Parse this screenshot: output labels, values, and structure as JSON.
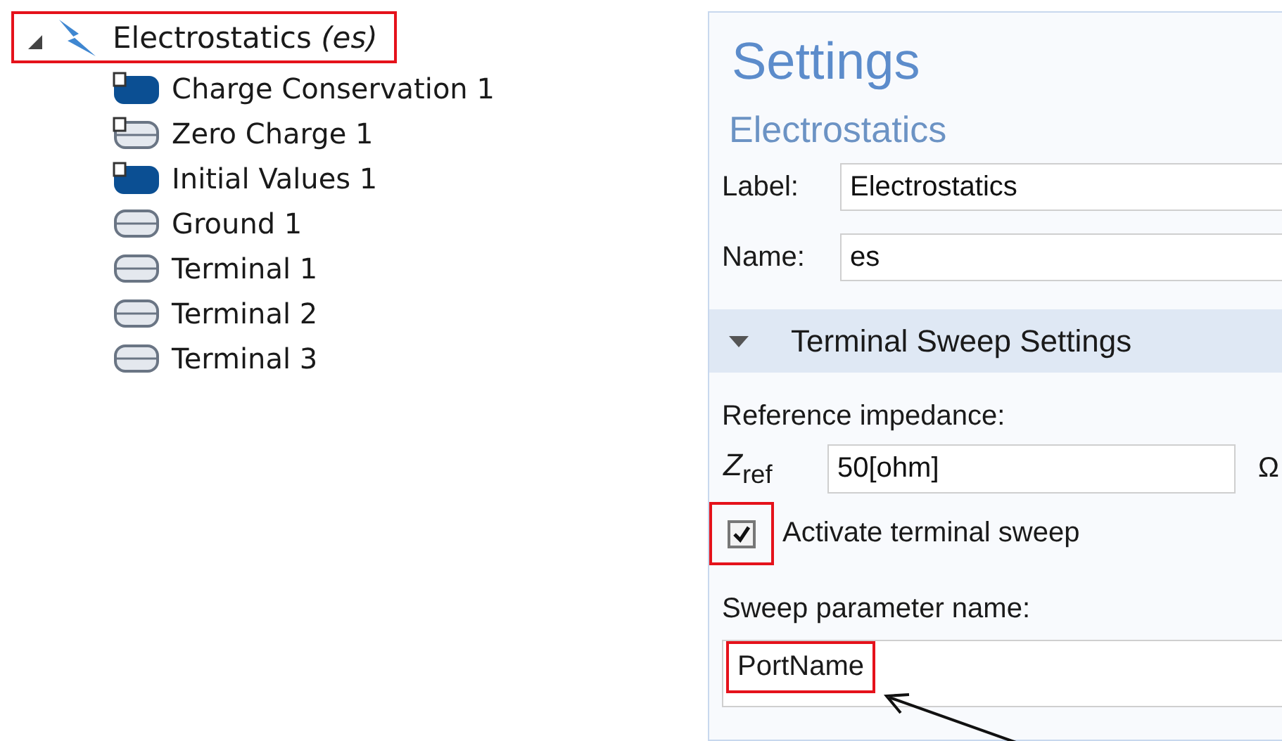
{
  "tree": {
    "root": {
      "label": "Electrostatics",
      "tag": "(es)",
      "expanded": true,
      "highlighted": true,
      "children": [
        {
          "label": "Charge Conservation 1",
          "kind": "default_filled"
        },
        {
          "label": "Zero Charge 1",
          "kind": "default_outline"
        },
        {
          "label": "Initial Values 1",
          "kind": "default_filled"
        },
        {
          "label": "Ground 1",
          "kind": "outline"
        },
        {
          "label": "Terminal 1",
          "kind": "outline"
        },
        {
          "label": "Terminal 2",
          "kind": "outline"
        },
        {
          "label": "Terminal 3",
          "kind": "outline"
        }
      ]
    }
  },
  "settings": {
    "title": "Settings",
    "subtitle": "Electrostatics",
    "fields": [
      {
        "label": "Label:",
        "value": "Electrostatics"
      },
      {
        "label": "Name:",
        "value": "es"
      }
    ],
    "section": {
      "title": "Terminal Sweep Settings",
      "expanded": true,
      "reference_label": "Reference impedance:",
      "zref": {
        "symbol": "*Z*$_{ref}$",
        "value": "50[ohm]",
        "unit": "Ω"
      },
      "checkbox": {
        "label": "Activate terminal sweep",
        "checked": true,
        "highlighted": true
      },
      "param_label": "Sweep parameter name:",
      "param": {
        "value": "PortName",
        "highlighted": true,
        "arrow": true
      }
    }
  }
}
